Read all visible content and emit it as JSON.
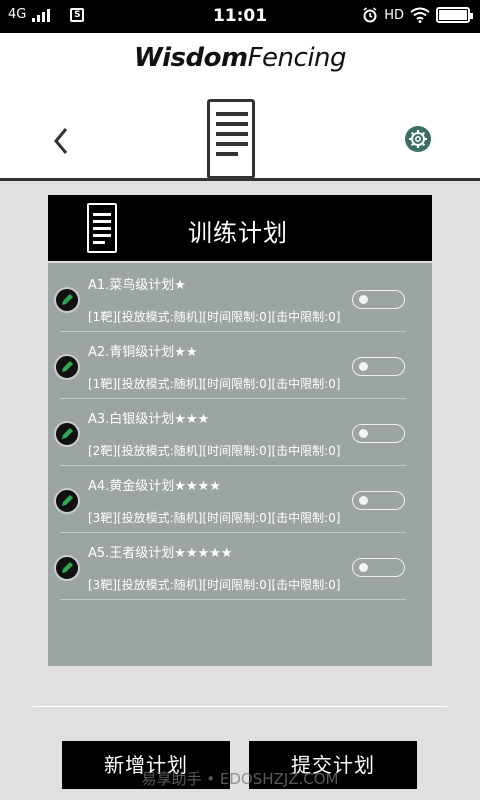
{
  "status_bar": {
    "network": "4G",
    "carrier_icon": "S",
    "time": "11:01",
    "hd": "HD",
    "icons": [
      "alarm-icon",
      "wifi-icon",
      "battery-icon"
    ],
    "battery_level": 1.0
  },
  "header": {
    "brand_bold": "Wisdom",
    "brand_light": "Fencing",
    "back_icon": "chevron-left-icon",
    "center_icon": "document-list-icon",
    "settings_icon": "gear-icon",
    "settings_color": "#3b6f63"
  },
  "panel": {
    "title": "训练计划",
    "background": "#9da4a4",
    "plans": [
      {
        "name": "A1.菜鸟级计划★",
        "desc": "[1靶][投放模式:随机][时间限制:0][击中限制:0]",
        "enabled": false
      },
      {
        "name": "A2.青铜级计划★★",
        "desc": "[1靶][投放模式:随机][时间限制:0][击中限制:0]",
        "enabled": false
      },
      {
        "name": "A3.白银级计划★★★",
        "desc": "[2靶][投放模式:随机][时间限制:0][击中限制:0]",
        "enabled": false
      },
      {
        "name": "A4.黄金级计划★★★★",
        "desc": "[3靶][投放模式:随机][时间限制:0][击中限制:0]",
        "enabled": false
      },
      {
        "name": "A5.王者级计划★★★★★",
        "desc": "[3靶][投放模式:随机][时间限制:0][击中限制:0]",
        "enabled": false
      }
    ]
  },
  "buttons": {
    "add": "新增计划",
    "submit": "提交计划"
  },
  "watermark": "易享助手 • EDOSHZJZ.COM"
}
